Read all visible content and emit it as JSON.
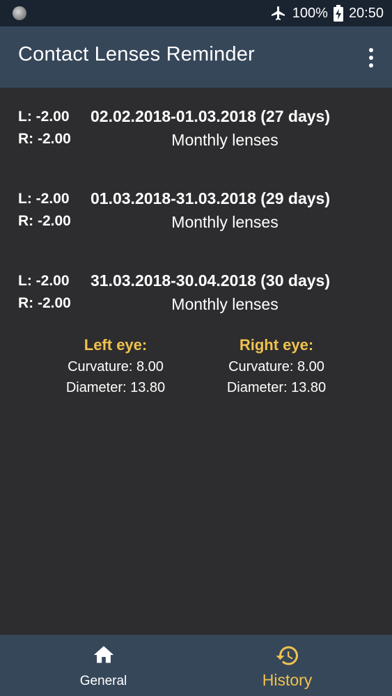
{
  "status_bar": {
    "battery": "100%",
    "time": "20:50",
    "icons": [
      "notification-dot-icon",
      "airplane-icon",
      "battery-charging-icon"
    ]
  },
  "app_bar": {
    "title": "Contact Lenses Reminder",
    "menu_icon": "overflow-menu-icon"
  },
  "history": {
    "entries": [
      {
        "left": "L: -2.00",
        "right": "R: -2.00",
        "period": "02.02.2018-01.03.2018 (27 days)",
        "type": "Monthly lenses"
      },
      {
        "left": "L: -2.00",
        "right": "R: -2.00",
        "period": "01.03.2018-31.03.2018 (29 days)",
        "type": "Monthly lenses"
      },
      {
        "left": "L: -2.00",
        "right": "R: -2.00",
        "period": "31.03.2018-30.04.2018 (30 days)",
        "type": "Monthly lenses"
      }
    ]
  },
  "eyes": {
    "left": {
      "title": "Left eye:",
      "curvature": "Curvature: 8.00",
      "diameter": "Diameter: 13.80"
    },
    "right": {
      "title": "Right eye:",
      "curvature": "Curvature: 8.00",
      "diameter": "Diameter: 13.80"
    }
  },
  "bottom_nav": {
    "items": [
      {
        "label": "General",
        "icon": "home-icon",
        "active": false
      },
      {
        "label": "History",
        "icon": "history-icon",
        "active": true
      }
    ]
  },
  "colors": {
    "background": "#2d2d2f",
    "app_bar": "#37475a",
    "status_bar": "#1a2330",
    "accent": "#f0c24e",
    "text": "#ffffff"
  }
}
